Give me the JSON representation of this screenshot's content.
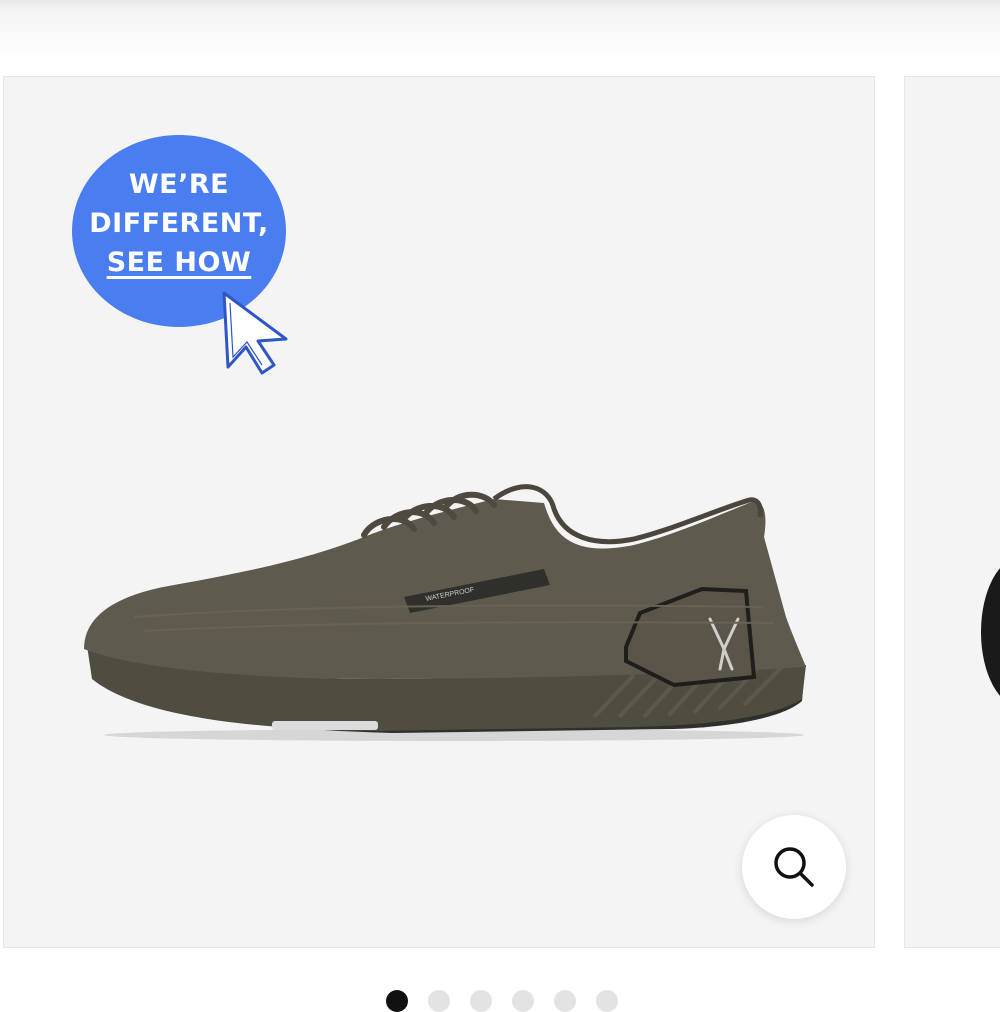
{
  "badge": {
    "line1": "WE’RE",
    "line2": "DIFFERENT,",
    "line3": "SEE HOW",
    "color": "#4a7ef0"
  },
  "product_image": {
    "shoe_tag_text": "WATERPROOF",
    "shoe_color": "#5f5a4e",
    "sole_color": "#4f4c40"
  },
  "zoom": {
    "icon": "search-icon"
  },
  "carousel": {
    "page_count": 6,
    "active_index": 0
  }
}
